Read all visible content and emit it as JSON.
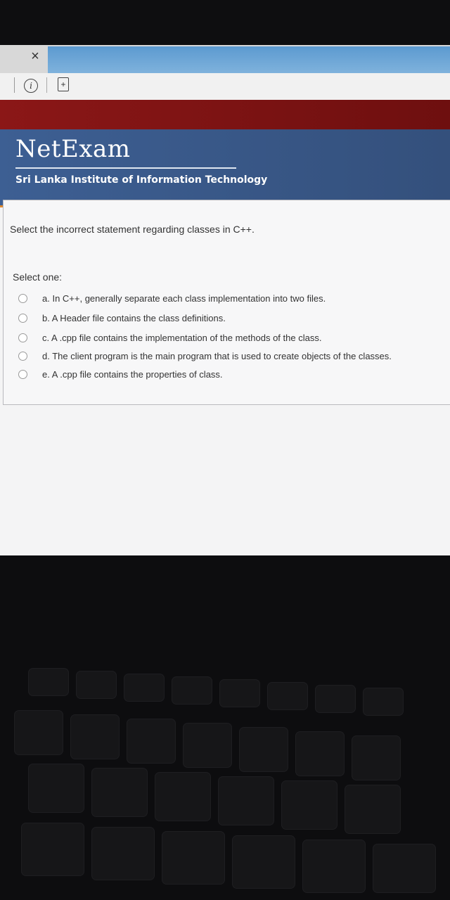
{
  "browser": {
    "close_tab_glyph": "×"
  },
  "header": {
    "brand": "NetExam",
    "institute": "Sri Lanka Institute of Information Technology"
  },
  "question": {
    "text": "Select the incorrect statement regarding classes in C++.",
    "prompt": "Select one:",
    "options": [
      {
        "label": "a. In C++, generally separate each class implementation into two files."
      },
      {
        "label": "b. A Header file contains the class definitions."
      },
      {
        "label": "c. A .cpp file contains the implementation of the methods of the class."
      },
      {
        "label": "d. The client program is the main program that is used to create objects of the classes."
      },
      {
        "label": "e. A .cpp file contains the properties of class."
      }
    ]
  },
  "colors": {
    "header_blue": "#3d5f93",
    "top_band_red": "#8b1717",
    "accent_orange": "#e08a2e"
  }
}
